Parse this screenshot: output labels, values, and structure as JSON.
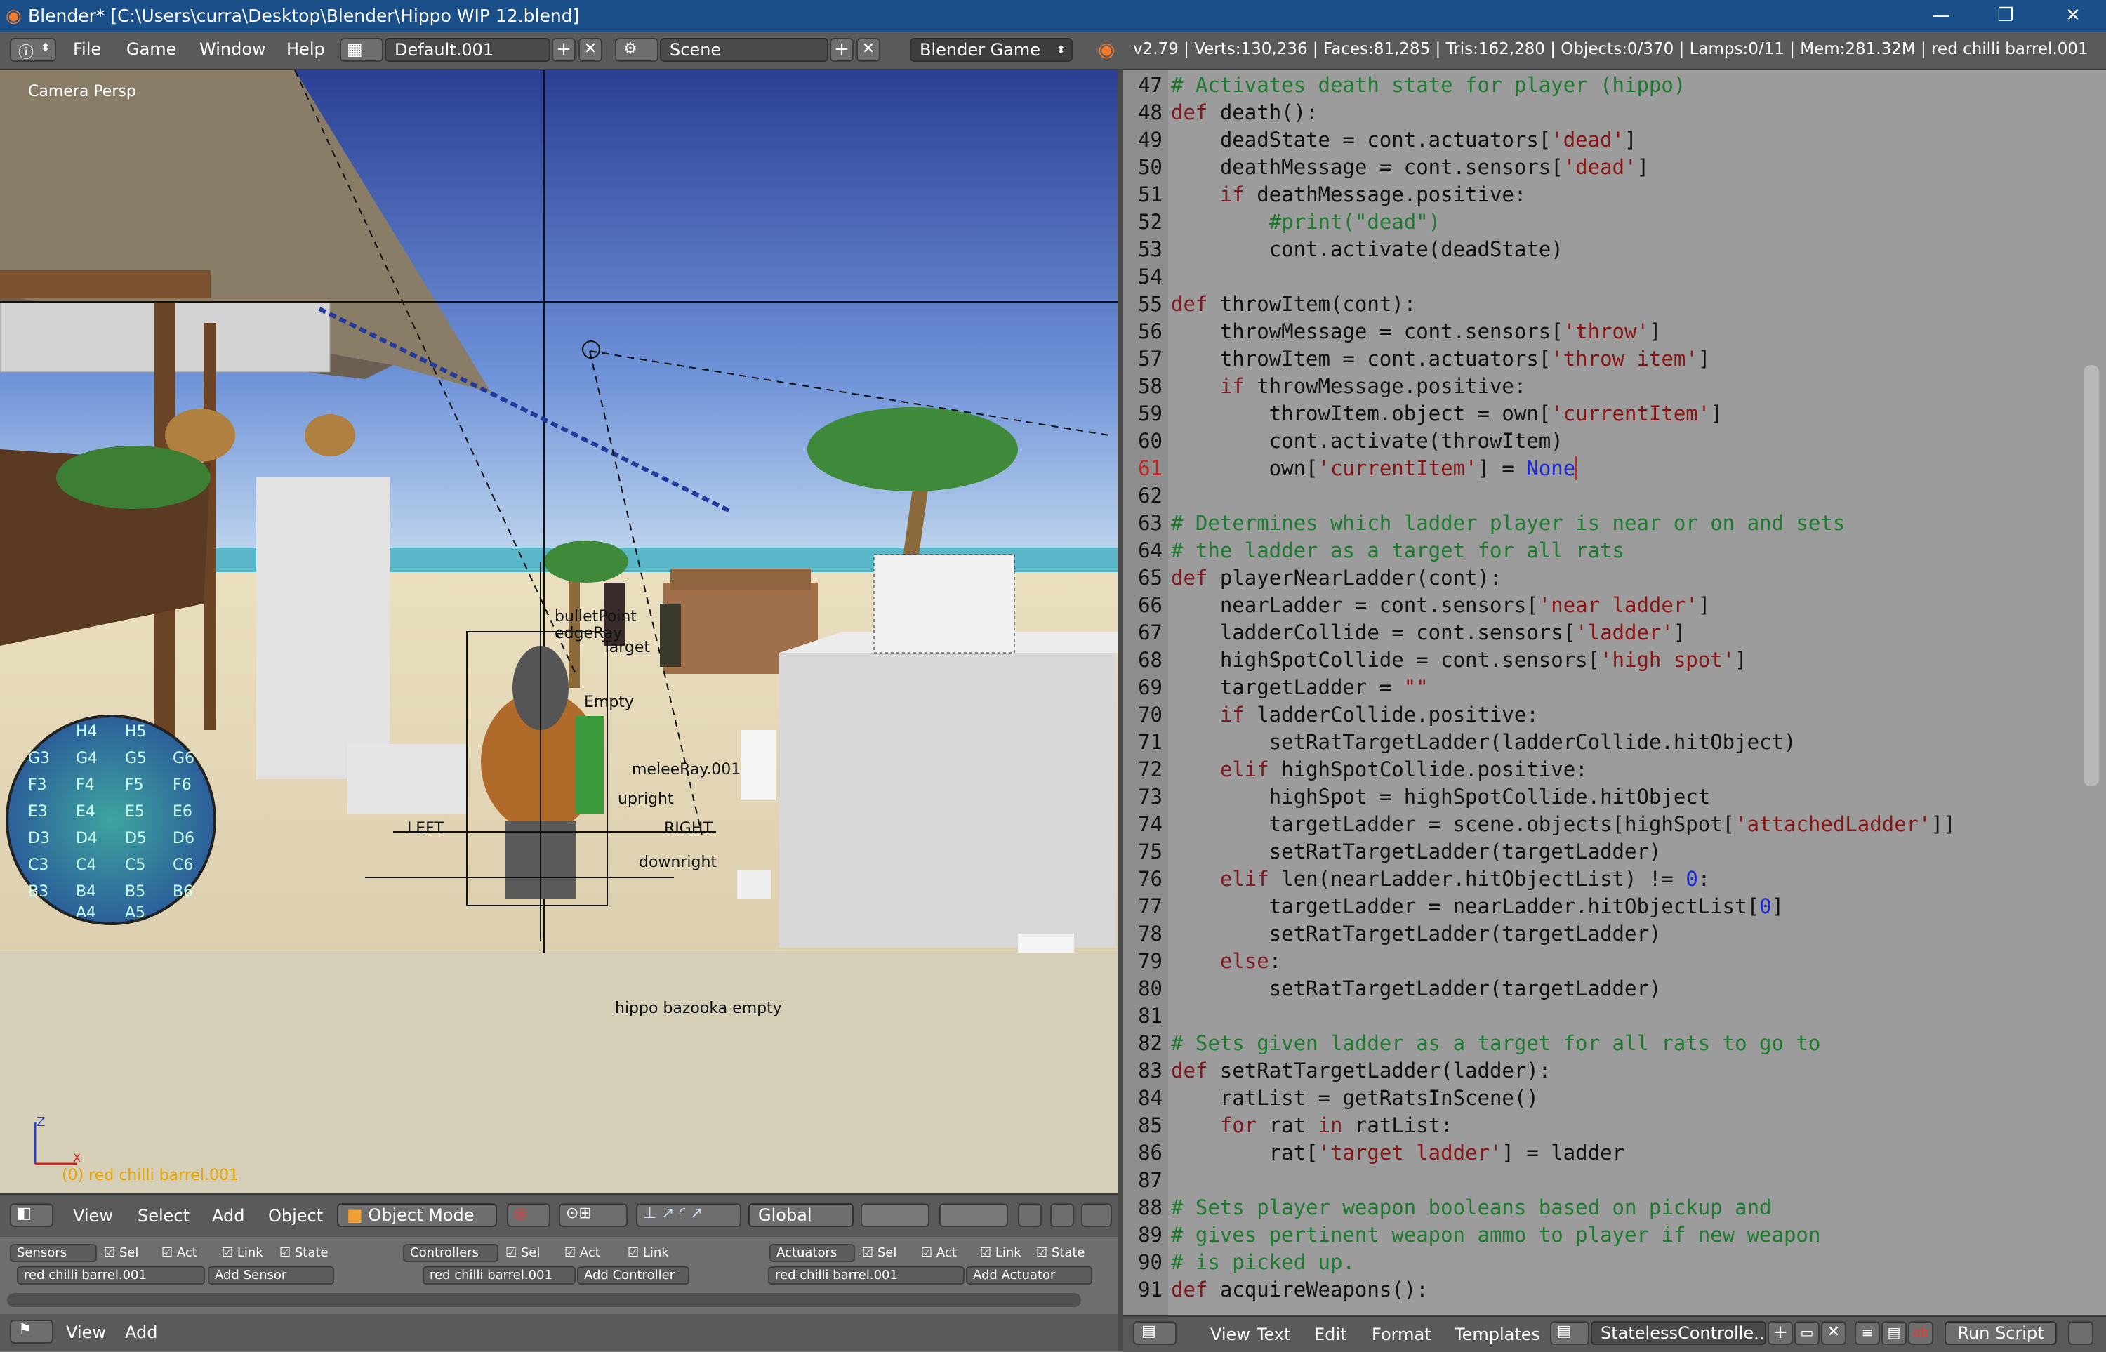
{
  "titlebar": {
    "app_title": "Blender* [C:\\Users\\curra\\Desktop\\Blender\\Hippo WIP 12.blend]"
  },
  "header": {
    "menus": [
      "File",
      "Game",
      "Window",
      "Help"
    ],
    "screen_layout": "Default.001",
    "scene": "Scene",
    "engine": "Blender Game",
    "stats": "v2.79 | Verts:130,236 | Faces:81,285 | Tris:162,280 | Objects:0/370 | Lamps:0/11 | Mem:281.32M | red chilli barrel.001"
  },
  "viewport": {
    "view_name": "Camera Persp",
    "active_object": "(0) red chilli barrel.001",
    "object_label": "hippo bazooka empty",
    "axis_z": "Z",
    "axis_x": "X",
    "labels": {
      "bullet": "bulletPoint",
      "edge_ray": "edgeRay",
      "target": "Target",
      "empty": "Empty",
      "melee": "meleeRay.001",
      "upright": "upright",
      "right": "RIGHT",
      "left": "LEFT",
      "downright": "downright"
    },
    "grid_cells": [
      [
        "H4",
        "H5"
      ],
      [
        "G3",
        "G4",
        "G5",
        "G6"
      ],
      [
        "F3",
        "F4",
        "F5",
        "F6"
      ],
      [
        "E3",
        "E4",
        "E5",
        "E6"
      ],
      [
        "D3",
        "D4",
        "D5",
        "D6"
      ],
      [
        "C3",
        "C4",
        "C5",
        "C6"
      ],
      [
        "B3",
        "B4",
        "B5",
        "B6"
      ],
      [
        "A4",
        "A5"
      ]
    ]
  },
  "view3d_header": {
    "menus": [
      "View",
      "Select",
      "Add",
      "Object"
    ],
    "mode": "Object Mode",
    "orientation": "Global"
  },
  "logic": {
    "sensors": {
      "label": "Sensors",
      "object": "red chilli barrel.001",
      "add": "Add Sensor"
    },
    "controllers": {
      "label": "Controllers",
      "object": "red chilli barrel.001",
      "add": "Add Controller"
    },
    "actuators": {
      "label": "Actuators",
      "object": "red chilli barrel.001",
      "add": "Add Actuator"
    },
    "toggles": {
      "sel": "Sel",
      "act": "Act",
      "link": "Link",
      "state": "State"
    }
  },
  "logic_footer": {
    "menus": [
      "View",
      "Add"
    ]
  },
  "editor": {
    "current_line": 61,
    "lines": [
      {
        "n": 47,
        "html": "<span class='cm'># Activates death state for player (hippo)</span>"
      },
      {
        "n": 48,
        "html": "<span class='kw'>def</span> death():"
      },
      {
        "n": 49,
        "html": "    deadState = cont.actuators[<span class='str'>'dead'</span>]"
      },
      {
        "n": 50,
        "html": "    deathMessage = cont.sensors[<span class='str'>'dead'</span>]"
      },
      {
        "n": 51,
        "html": "    <span class='kw'>if</span> deathMessage.positive:"
      },
      {
        "n": 52,
        "html": "        <span class='cm'>#print(\"dead\")</span>"
      },
      {
        "n": 53,
        "html": "        cont.activate(deadState)"
      },
      {
        "n": 54,
        "html": ""
      },
      {
        "n": 55,
        "html": "<span class='kw'>def</span> throwItem(cont):"
      },
      {
        "n": 56,
        "html": "    throwMessage = cont.sensors[<span class='str'>'throw'</span>]"
      },
      {
        "n": 57,
        "html": "    throwItem = cont.actuators[<span class='str'>'throw item'</span>]"
      },
      {
        "n": 58,
        "html": "    <span class='kw'>if</span> throwMessage.positive:"
      },
      {
        "n": 59,
        "html": "        throwItem.object = own[<span class='str'>'currentItem'</span>]"
      },
      {
        "n": 60,
        "html": "        cont.activate(throwItem)"
      },
      {
        "n": 61,
        "html": "        own[<span class='str'>'currentItem'</span>] = <span class='num'>None</span><span style='border-left:2px solid #c8231e'></span>"
      },
      {
        "n": 62,
        "html": ""
      },
      {
        "n": 63,
        "html": "<span class='cm'># Determines which ladder player is near or on and sets</span>"
      },
      {
        "n": 64,
        "html": "<span class='cm'># the ladder as a target for all rats</span>"
      },
      {
        "n": 65,
        "html": "<span class='kw'>def</span> playerNearLadder(cont):"
      },
      {
        "n": 66,
        "html": "    nearLadder = cont.sensors[<span class='str'>'near ladder'</span>]"
      },
      {
        "n": 67,
        "html": "    ladderCollide = cont.sensors[<span class='str'>'ladder'</span>]"
      },
      {
        "n": 68,
        "html": "    highSpotCollide = cont.sensors[<span class='str'>'high spot'</span>]"
      },
      {
        "n": 69,
        "html": "    targetLadder = <span class='str'>\"\"</span>"
      },
      {
        "n": 70,
        "html": "    <span class='kw'>if</span> ladderCollide.positive:"
      },
      {
        "n": 71,
        "html": "        setRatTargetLadder(ladderCollide.hitObject)"
      },
      {
        "n": 72,
        "html": "    <span class='kw'>elif</span> highSpotCollide.positive:"
      },
      {
        "n": 73,
        "html": "        highSpot = highSpotCollide.hitObject"
      },
      {
        "n": 74,
        "html": "        targetLadder = scene.objects[highSpot[<span class='str'>'attachedLadder'</span>]]"
      },
      {
        "n": 75,
        "html": "        setRatTargetLadder(targetLadder)"
      },
      {
        "n": 76,
        "html": "    <span class='kw'>elif</span> len(nearLadder.hitObjectList) != <span class='num'>0</span>:"
      },
      {
        "n": 77,
        "html": "        targetLadder = nearLadder.hitObjectList[<span class='num'>0</span>]"
      },
      {
        "n": 78,
        "html": "        setRatTargetLadder(targetLadder)"
      },
      {
        "n": 79,
        "html": "    <span class='kw'>else</span>:"
      },
      {
        "n": 80,
        "html": "        setRatTargetLadder(targetLadder)"
      },
      {
        "n": 81,
        "html": ""
      },
      {
        "n": 82,
        "html": "<span class='cm'># Sets given ladder as a target for all rats to go to</span>"
      },
      {
        "n": 83,
        "html": "<span class='kw'>def</span> setRatTargetLadder(ladder):"
      },
      {
        "n": 84,
        "html": "    ratList = getRatsInScene()"
      },
      {
        "n": 85,
        "html": "    <span class='kw'>for</span> rat <span class='kw'>in</span> ratList:"
      },
      {
        "n": 86,
        "html": "        rat[<span class='str'>'target ladder'</span>] = ladder"
      },
      {
        "n": 87,
        "html": ""
      },
      {
        "n": 88,
        "html": "<span class='cm'># Sets player weapon booleans based on pickup and</span>"
      },
      {
        "n": 89,
        "html": "<span class='cm'># gives pertinent weapon ammo to player if new weapon</span>"
      },
      {
        "n": 90,
        "html": "<span class='cm'># is picked up.</span>"
      },
      {
        "n": 91,
        "html": "<span class='kw'>def</span> acquireWeapons():"
      }
    ]
  },
  "editor_footer": {
    "menus": [
      "View",
      "Text",
      "Edit",
      "Format",
      "Templates"
    ],
    "text_block": "StatelessControlle...",
    "run_script": "Run Script"
  }
}
